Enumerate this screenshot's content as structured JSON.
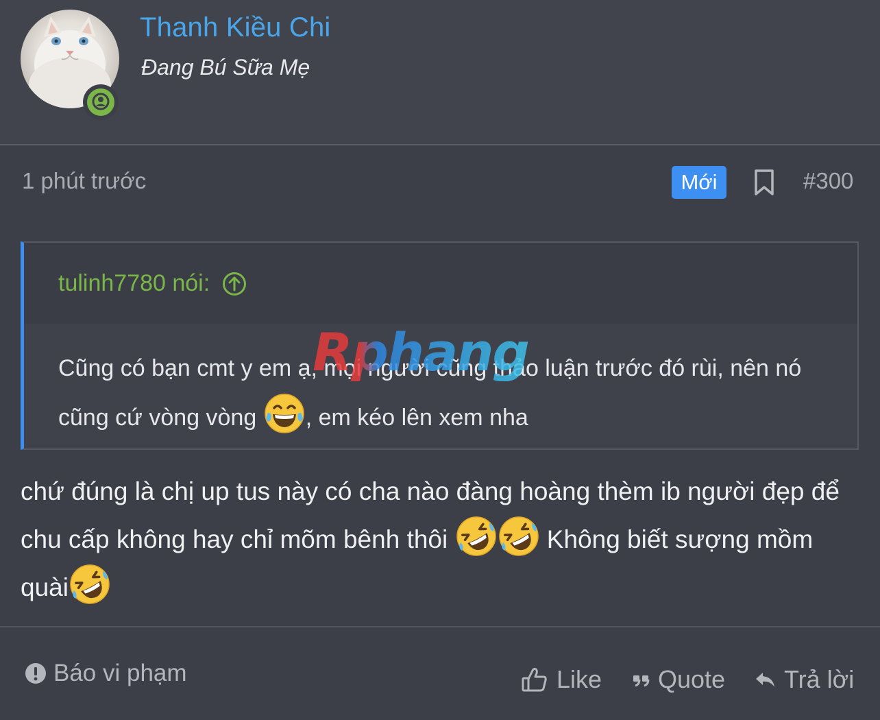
{
  "author": {
    "name": "Thanh Kiều Chi",
    "title": "Đang Bú Sữa Mẹ"
  },
  "post_meta": {
    "time": "1 phút trước",
    "new_badge": "Mới",
    "post_number": "#300"
  },
  "quote": {
    "author_label": "tulinh7780 nói:",
    "text_part1": "Cũng có bạn cmt y em ạ, mọi người cũng thảo luận trước đó rùi, nên nó cũng cứ vòng vòng ",
    "text_part2": ", em kéo lên xem nha"
  },
  "message": {
    "text_part1": "chứ đúng là chị up tus này có cha nào đàng hoàng thèm ib người đẹp để chu cấp không hay chỉ mõm bênh thôi ",
    "text_part2": " Không biết sượng mồm quài"
  },
  "watermark_text": "Rphang",
  "footer": {
    "report_label": "Báo vi phạm",
    "like_label": "Like",
    "quote_label": "Quote",
    "reply_label": "Trả lời"
  },
  "colors": {
    "username": "#4aa6ea",
    "quote_author": "#7ab648",
    "accent": "#3d8ff2",
    "online": "#7ab648",
    "background": "#3c3f47"
  },
  "icons": [
    "user-online-icon",
    "bookmark-icon",
    "arrow-up-circle-icon",
    "tears-of-joy-emoji",
    "rofl-emoji",
    "exclamation-circle-icon",
    "thumbs-up-icon",
    "quote-marks-icon",
    "reply-arrow-icon"
  ]
}
